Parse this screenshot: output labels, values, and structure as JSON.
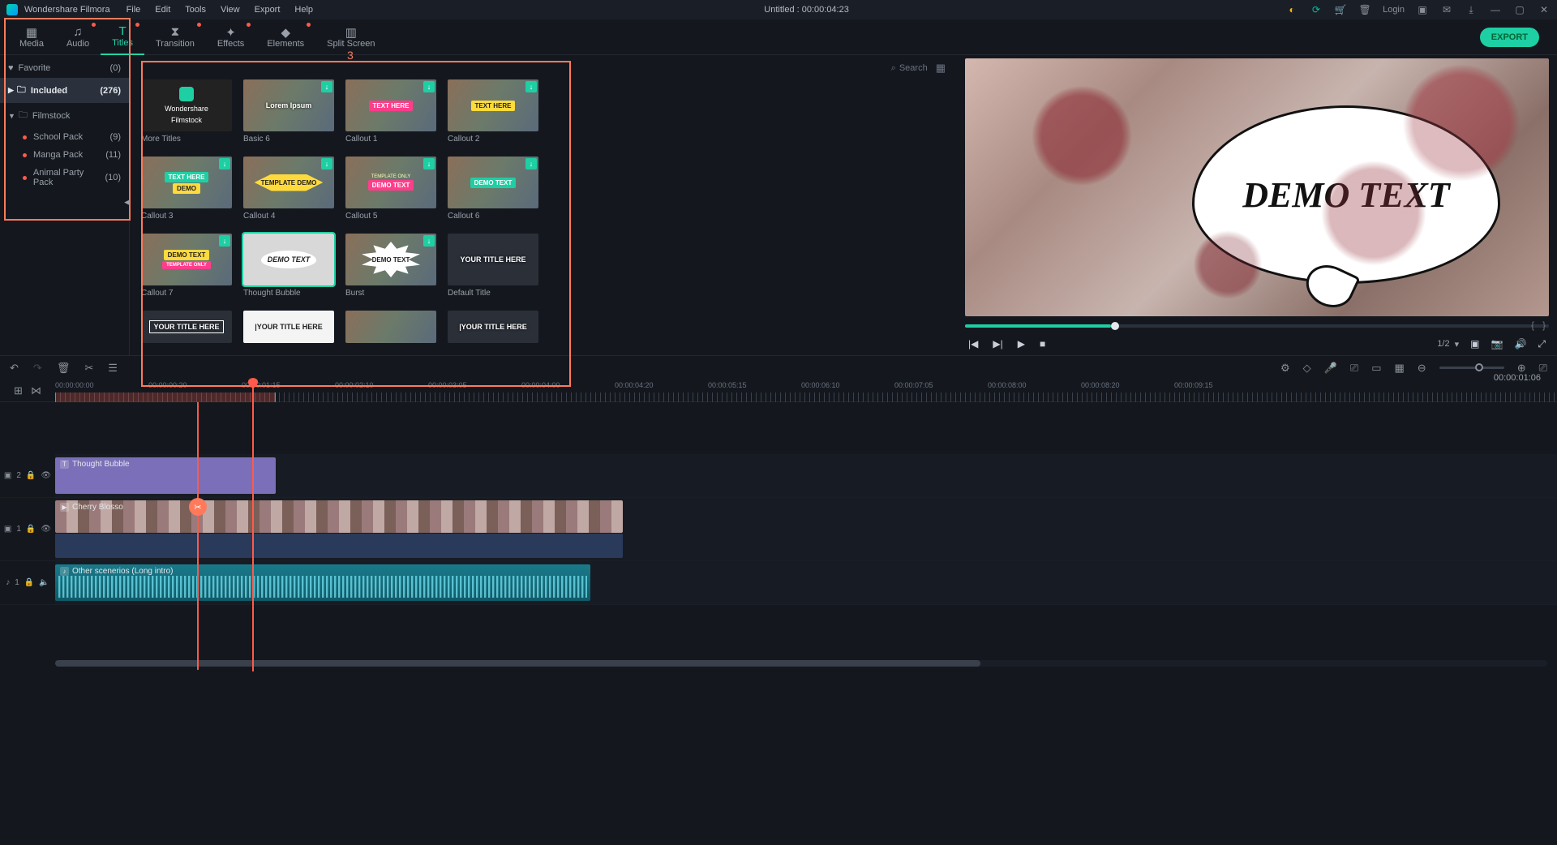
{
  "app": {
    "name": "Wondershare Filmora",
    "title_center": "Untitled : 00:00:04:23"
  },
  "menus": [
    "File",
    "Edit",
    "Tools",
    "View",
    "Export",
    "Help"
  ],
  "titlebar_right": {
    "login": "Login"
  },
  "tabs": [
    {
      "id": "media",
      "label": "Media",
      "active": false,
      "dot": false
    },
    {
      "id": "audio",
      "label": "Audio",
      "active": false,
      "dot": true
    },
    {
      "id": "titles",
      "label": "Titles",
      "active": true,
      "dot": true
    },
    {
      "id": "transition",
      "label": "Transition",
      "active": false,
      "dot": true
    },
    {
      "id": "effects",
      "label": "Effects",
      "active": false,
      "dot": true
    },
    {
      "id": "elements",
      "label": "Elements",
      "active": false,
      "dot": true
    },
    {
      "id": "splitscreen",
      "label": "Split Screen",
      "active": false,
      "dot": false
    }
  ],
  "export_label": "EXPORT",
  "sidebar": {
    "favorite": {
      "label": "Favorite",
      "count": "(0)"
    },
    "included": {
      "label": "Included",
      "count": "(276)"
    },
    "filmstock": {
      "label": "Filmstock"
    },
    "subs": [
      {
        "label": "School Pack",
        "count": "(9)"
      },
      {
        "label": "Manga Pack",
        "count": "(11)"
      },
      {
        "label": "Animal Party Pack",
        "count": "(10)"
      }
    ]
  },
  "search_placeholder": "Search",
  "cards": [
    {
      "label": "More Titles",
      "filmstock_line1": "Wondershare",
      "filmstock_line2": "Filmstock"
    },
    {
      "label": "Basic 6",
      "badge": "Lorem Ipsum"
    },
    {
      "label": "Callout 1",
      "badge": "TEXT HERE"
    },
    {
      "label": "Callout 2",
      "badge": "TEXT HERE"
    },
    {
      "label": "Callout 3",
      "badge": "TEXT HERE",
      "sub": "DEMO"
    },
    {
      "label": "Callout 4",
      "badge": "TEMPLATE DEMO"
    },
    {
      "label": "Callout 5",
      "badge": "DEMO TEXT",
      "pre": "TEMPLATE ONLY"
    },
    {
      "label": "Callout 6",
      "badge": "DEMO TEXT"
    },
    {
      "label": "Callout 7",
      "badge": "DEMO TEXT"
    },
    {
      "label": "Thought Bubble",
      "badge": "DEMO TEXT"
    },
    {
      "label": "Burst",
      "badge": "DEMO TEXT"
    },
    {
      "label": "Default Title",
      "badge": "YOUR TITLE HERE"
    },
    {
      "label": "",
      "badge": "YOUR TITLE HERE"
    },
    {
      "label": "",
      "badge": "|YOUR TITLE HERE"
    },
    {
      "label": "",
      "badge": ""
    },
    {
      "label": "",
      "badge": "|YOUR TITLE HERE"
    }
  ],
  "preview": {
    "bubble_text": "DEMO TEXT",
    "time": "00:00:01:06",
    "ratio": "1/2"
  },
  "ruler_ticks": [
    "00:00:00:00",
    "00:00:00:20",
    "00:00:01:15",
    "00:00:02:10",
    "00:00:03:05",
    "00:00:04:00",
    "00:00:04:20",
    "00:00:05:15",
    "00:00:06:10",
    "00:00:07:05",
    "00:00:08:00",
    "00:00:08:20",
    "00:00:09:15"
  ],
  "tracks": {
    "t2": {
      "head": "2",
      "clip": "Thought Bubble"
    },
    "t1": {
      "head": "1",
      "clip": "Cherry Blosso"
    },
    "a1": {
      "head": "1",
      "clip": "Other scenerios  (Long intro)"
    }
  },
  "annotation_label": "3"
}
